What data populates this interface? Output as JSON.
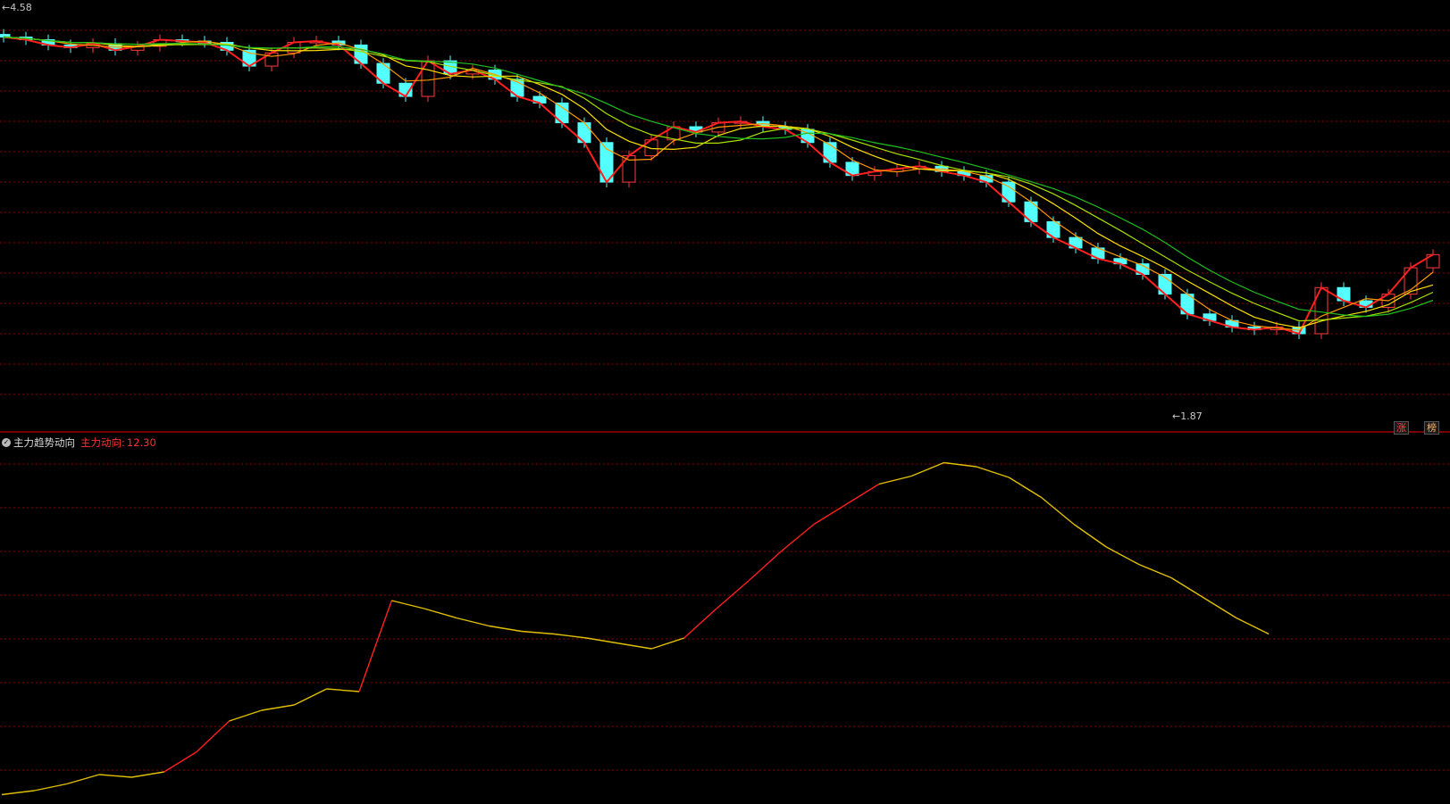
{
  "price_panel": {
    "high_label": "4.58",
    "low_label": "1.87",
    "badges": [
      "涨",
      "榜"
    ]
  },
  "indicator_panel": {
    "name": "主力趋势动向",
    "series_label": "主力动向:",
    "value": "12.30"
  },
  "colors": {
    "up": "#ff3b3b",
    "down": "#54ffff",
    "grid": "#8b0000",
    "separator": "#c00000",
    "indicator_line": "#e0c000",
    "indicator_rising": "#ff2020"
  },
  "chart_data": [
    {
      "type": "candlestick",
      "ylim": [
        1.6,
        4.7
      ],
      "x": [
        0,
        5,
        10,
        15,
        20,
        25,
        30,
        35,
        40,
        45,
        50,
        55,
        60,
        65,
        70,
        75,
        80,
        85,
        90,
        95,
        100,
        105,
        110,
        115,
        120,
        125,
        130,
        135,
        140,
        145,
        150,
        155,
        160,
        165,
        170,
        175,
        180,
        185,
        190,
        195,
        200,
        205,
        210,
        215,
        220,
        225,
        230,
        235,
        240,
        245,
        250,
        255,
        260,
        265,
        270,
        275,
        280,
        285,
        290,
        295,
        300,
        305,
        310,
        315,
        320
      ],
      "close": [
        4.5,
        4.48,
        4.44,
        4.42,
        4.45,
        4.4,
        4.43,
        4.48,
        4.47,
        4.46,
        4.4,
        4.28,
        4.38,
        4.46,
        4.47,
        4.44,
        4.3,
        4.15,
        4.05,
        4.32,
        4.22,
        4.25,
        4.18,
        4.05,
        4.0,
        3.85,
        3.7,
        3.4,
        3.6,
        3.72,
        3.82,
        3.78,
        3.85,
        3.86,
        3.82,
        3.8,
        3.7,
        3.55,
        3.45,
        3.48,
        3.5,
        3.52,
        3.48,
        3.45,
        3.4,
        3.25,
        3.1,
        2.98,
        2.9,
        2.82,
        2.78,
        2.7,
        2.55,
        2.4,
        2.35,
        2.3,
        2.28,
        2.3,
        2.25,
        2.6,
        2.5,
        2.45,
        2.55,
        2.75,
        2.85
      ],
      "candles_note": "OHLC per session; close values listed, body color red=up, cyan=down",
      "ma_lines": [
        "red",
        "orange",
        "yellow",
        "yellow-green",
        "green"
      ],
      "annotations": [
        {
          "type": "max",
          "label": "4.58"
        },
        {
          "type": "min",
          "label": "1.87"
        }
      ]
    },
    {
      "type": "line",
      "title": "主力趋势动向",
      "series": [
        {
          "name": "主力动向",
          "x": [
            0,
            10,
            20,
            30,
            40,
            50,
            60,
            70,
            80,
            90,
            100,
            105,
            110,
            120,
            125,
            130,
            135,
            140,
            150,
            160,
            170,
            180,
            190,
            200,
            210,
            215,
            220,
            230,
            235,
            240,
            250,
            255,
            260,
            265,
            270,
            275,
            280,
            285,
            290,
            295,
            300,
            305,
            310,
            315,
            320
          ],
          "values": [
            0.3,
            0.6,
            1.1,
            1.8,
            1.6,
            2.0,
            3.5,
            5.8,
            6.6,
            7.0,
            8.2,
            8.0,
            14.8,
            14.2,
            13.5,
            12.9,
            12.5,
            12.3,
            12.0,
            11.6,
            11.2,
            12.0,
            14.2,
            16.3,
            18.5,
            20.5,
            22.0,
            23.5,
            24.1,
            25.1,
            24.8,
            24.0,
            22.5,
            20.5,
            18.8,
            17.5,
            16.5,
            15.0,
            13.5,
            12.3,
            0,
            0,
            0,
            0,
            0
          ],
          "last_value": 12.3
        }
      ]
    }
  ]
}
